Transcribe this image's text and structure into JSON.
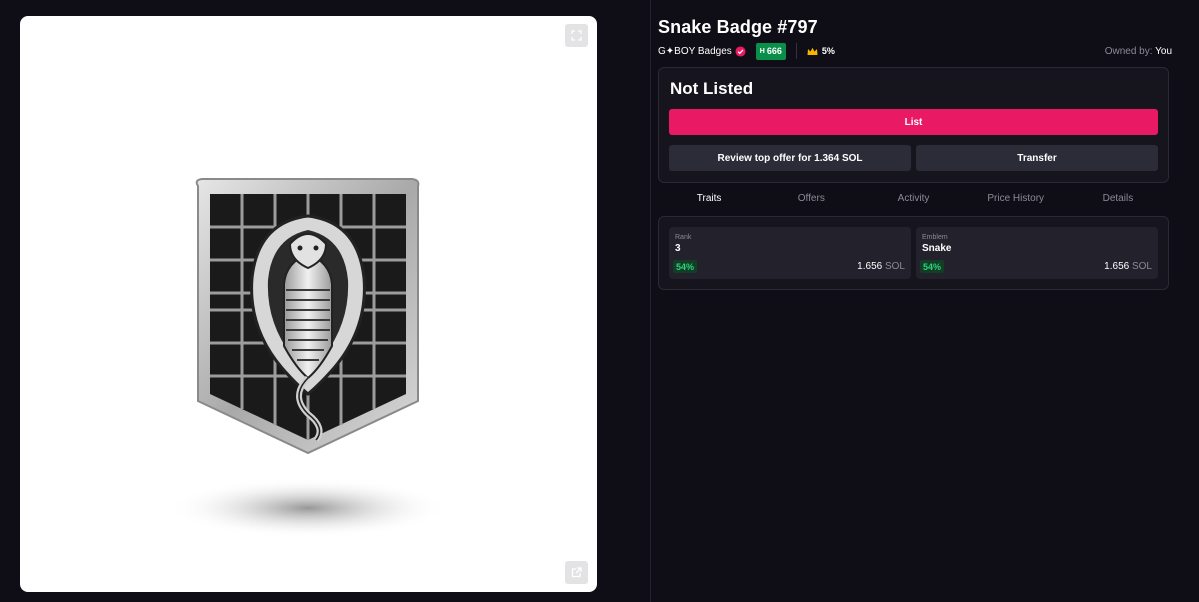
{
  "nft": {
    "title": "Snake Badge #797",
    "collection": "G✦BOY Badges",
    "rank_prefix": "H",
    "rank": "666",
    "royalty": "5%",
    "owned_label": "Owned by:",
    "owner": "You",
    "image_icon": "cobra-badge-icon"
  },
  "listing": {
    "status": "Not Listed",
    "list_label": "List",
    "offer_label": "Review top offer for 1.364 SOL",
    "transfer_label": "Transfer"
  },
  "tabs": [
    "Traits",
    "Offers",
    "Activity",
    "Price History",
    "Details"
  ],
  "active_tab": "Traits",
  "traits": [
    {
      "label": "Rank",
      "value": "3",
      "percent": "54%",
      "price": "1.656",
      "unit": "SOL"
    },
    {
      "label": "Emblem",
      "value": "Snake",
      "percent": "54%",
      "price": "1.656",
      "unit": "SOL"
    }
  ],
  "colors": {
    "background": "#0f0e16",
    "accent": "#e91963",
    "rank_badge": "#0a8f4b",
    "positive": "#2fd37a"
  }
}
